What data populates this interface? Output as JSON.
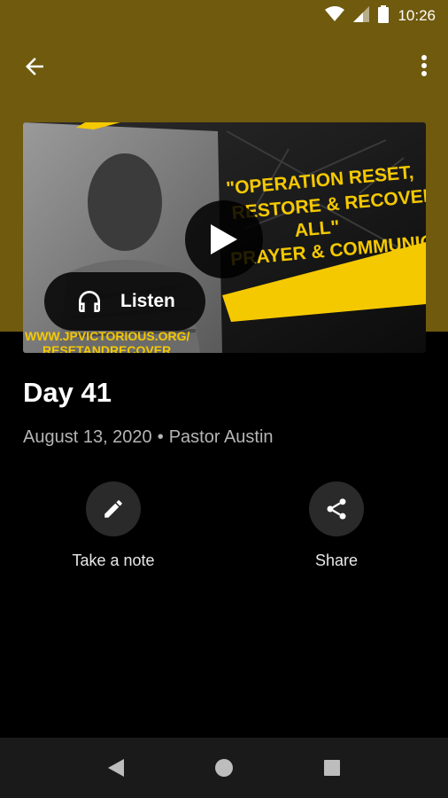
{
  "status_bar": {
    "time": "10:26"
  },
  "app_bar": {
    "back_icon": "arrow-back-icon",
    "menu_icon": "more-vert-icon"
  },
  "colors": {
    "header_bg": "#6f5a0e",
    "accent_yellow": "#f5c900",
    "background": "#000000"
  },
  "media": {
    "thumbnail_text": {
      "line1": "\"OPERATION RESET,",
      "line2": "RESTORE & RECOVER",
      "line3": "ALL\"",
      "line4": "PRAYER & COMMUNION",
      "url": "WWW.JPVICTORIOUS.ORG/",
      "url2": "RESETANDRECOVER"
    },
    "listen_label": "Listen"
  },
  "sermon": {
    "title": "Day 41",
    "date": "August 13, 2020",
    "separator": "•",
    "speaker": "Pastor Austin"
  },
  "actions": [
    {
      "label": "Take a note",
      "icon": "pencil-icon"
    },
    {
      "label": "Share",
      "icon": "share-icon"
    }
  ],
  "nav_bar": {
    "back": "back-triangle-icon",
    "home": "home-circle-icon",
    "recents": "recents-square-icon"
  }
}
